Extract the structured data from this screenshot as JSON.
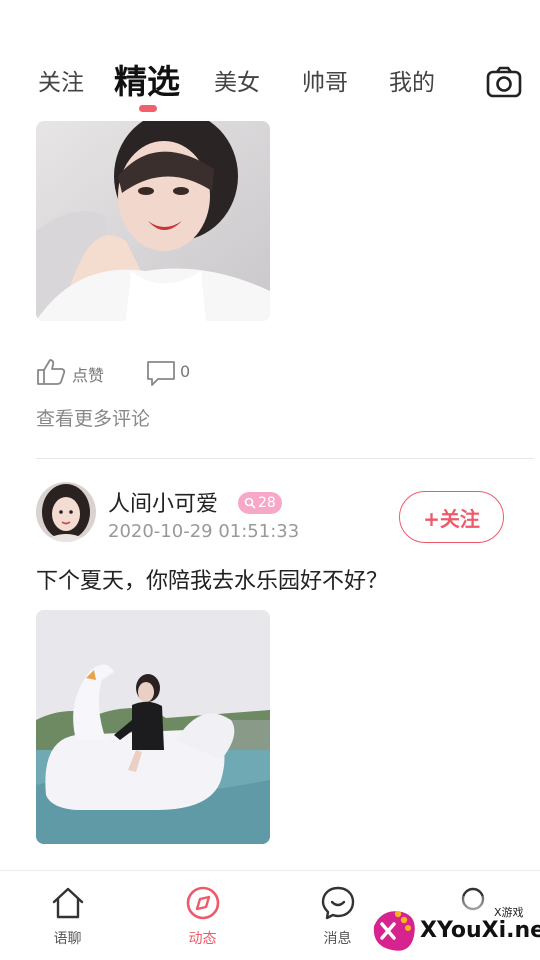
{
  "header": {
    "tabs": [
      {
        "label": "关注"
      },
      {
        "label": "精选"
      },
      {
        "label": "美女"
      },
      {
        "label": "帅哥"
      },
      {
        "label": "我的"
      }
    ],
    "active_tab": "精选",
    "camera_icon": "camera-icon"
  },
  "feed": {
    "previous_post": {
      "like_label": "点赞",
      "comment_count": "0",
      "more_comments": "查看更多评论"
    },
    "post": {
      "username": "人间小可爱",
      "level": "28",
      "time": "2020-10-29 01:51:33",
      "follow_label": "+关注",
      "text": "下个夏天，你陪我去水乐园好不好？"
    }
  },
  "bottom_nav": {
    "items": [
      {
        "label": "语聊",
        "icon": "home-icon"
      },
      {
        "label": "动态",
        "icon": "compass-icon"
      },
      {
        "label": "消息",
        "icon": "message-smile-icon"
      },
      {
        "label": "",
        "icon": "profile-icon"
      }
    ],
    "active": "动态"
  },
  "watermark": {
    "small": "X游戏",
    "big": "XYouXi.net"
  },
  "colors": {
    "accent": "#ee5a6a",
    "badge": "#f7a8c9",
    "text": "#222222",
    "muted": "#999999"
  }
}
